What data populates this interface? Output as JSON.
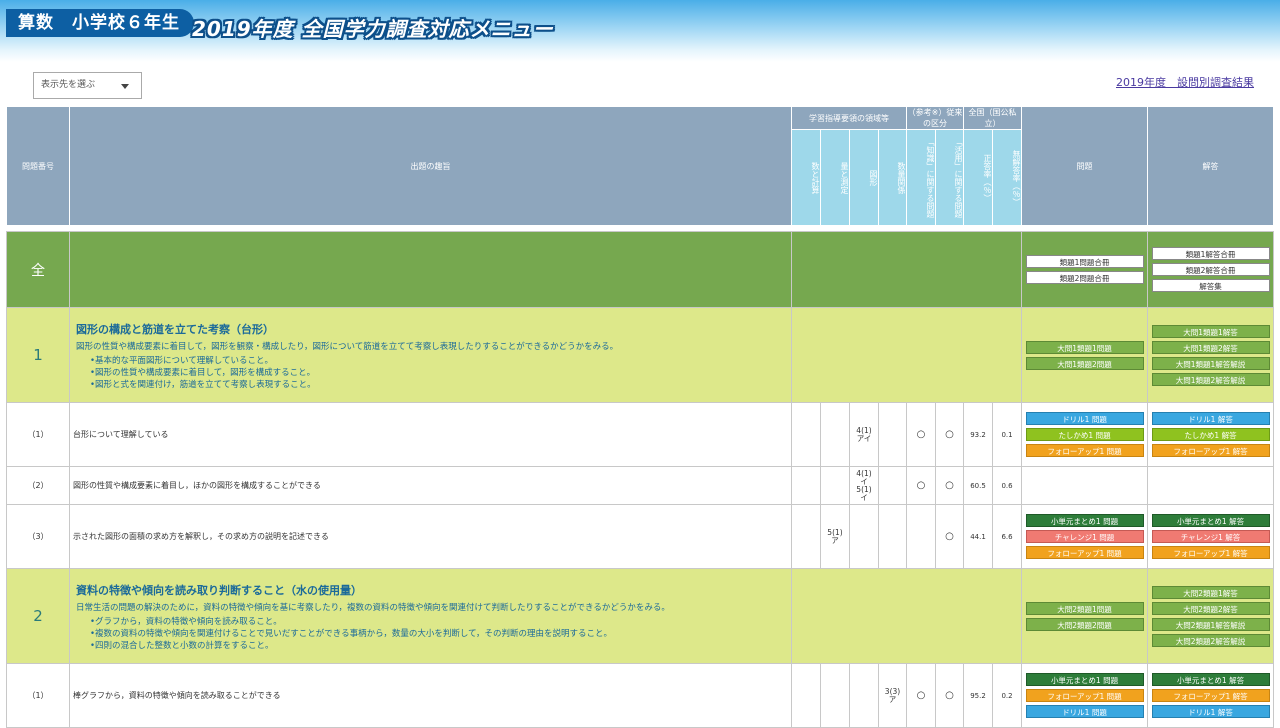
{
  "header": {
    "subject": "算数　小学校６年生",
    "title": "2019年度 全国学力調査対応メニュー"
  },
  "toolbar": {
    "select_value": "表示先を選ぶ",
    "link": "2019年度　設問別調査結果"
  },
  "columns": {
    "qnum": "問題番号",
    "aim": "出題の趣旨",
    "group1": "学習指導要領の領域等",
    "sub1": [
      "数と計算",
      "量と測定",
      "図形",
      "数量関係"
    ],
    "group2": "（参考※）従来の区分",
    "sub2": [
      "「知識」に関する問題",
      "「活用」に関する問題"
    ],
    "group3": "全国（国公私立）",
    "sub3": [
      "正答率（％）",
      "無解答率（％）"
    ],
    "problem": "問題",
    "answer": "解答"
  },
  "all_row": {
    "label": "全",
    "problem_buttons": [
      "類題1問題合冊",
      "類題2問題合冊"
    ],
    "answer_buttons": [
      "類題1解答合冊",
      "類題2解答合冊",
      "解答集"
    ]
  },
  "sections": [
    {
      "num": "1",
      "title": "図形の構成と筋道を立てた考察（台形）",
      "desc": "図形の性質や構成要素に着目して，図形を観察・構成したり，図形について筋道を立てて考察し表現したりすることができるかどうかをみる。",
      "bullets": [
        "基本的な平面図形について理解していること。",
        "図形の性質や構成要素に着目して，図形を構成すること。",
        "図形と式を関連付け，筋道を立てて考察し表現すること。"
      ],
      "problem_buttons": [
        "大問1類題1問題",
        "大問1類題2問題"
      ],
      "answer_buttons": [
        "大問1類題1解答",
        "大問1類題2解答",
        "大問1類題1解答解説",
        "大問1類題2解答解説"
      ],
      "subs": [
        {
          "num": "（1）",
          "aim": "台形について理解している",
          "c1": "",
          "c2": "",
          "c3": "4(1)\nアイ",
          "c4": "",
          "k1": "○",
          "k2": "○",
          "rate": "93.2",
          "none": "0.1",
          "problem_buttons": [
            {
              "t": "ドリル1 問題",
              "c": "blue"
            },
            {
              "t": "たしかめ1 問題",
              "c": "lime"
            },
            {
              "t": "フォローアップ1 問題",
              "c": "orange"
            }
          ],
          "answer_buttons": [
            {
              "t": "ドリル1 解答",
              "c": "blue"
            },
            {
              "t": "たしかめ1 解答",
              "c": "lime"
            },
            {
              "t": "フォローアップ1 解答",
              "c": "orange"
            }
          ]
        },
        {
          "num": "（2）",
          "aim": "図形の性質や構成要素に着目し，ほかの図形を構成することができる",
          "c1": "",
          "c2": "",
          "c3": "4(1)\nイ\n5(1)\nイ",
          "c4": "",
          "k1": "○",
          "k2": "○",
          "rate": "60.5",
          "none": "0.6",
          "problem_buttons": [],
          "answer_buttons": []
        },
        {
          "num": "（3）",
          "aim": "示された図形の面積の求め方を解釈し，その求め方の説明を記述できる",
          "c1": "",
          "c2": "5(1)\nア",
          "c3": "",
          "c4": "",
          "k1": "",
          "k2": "○",
          "rate": "44.1",
          "none": "6.6",
          "problem_buttons": [
            {
              "t": "小単元まとめ1 問題",
              "c": "dgreen"
            },
            {
              "t": "チャレンジ1 問題",
              "c": "red"
            },
            {
              "t": "フォローアップ1 問題",
              "c": "orange"
            }
          ],
          "answer_buttons": [
            {
              "t": "小単元まとめ1 解答",
              "c": "dgreen"
            },
            {
              "t": "チャレンジ1 解答",
              "c": "red"
            },
            {
              "t": "フォローアップ1 解答",
              "c": "orange"
            }
          ]
        }
      ]
    },
    {
      "num": "2",
      "title": "資料の特徴や傾向を読み取り判断すること（水の使用量）",
      "desc": "日常生活の問題の解決のために，資料の特徴や傾向を基に考察したり，複数の資料の特徴や傾向を関連付けて判断したりすることができるかどうかをみる。",
      "bullets": [
        "グラフから，資料の特徴や傾向を読み取ること。",
        "複数の資料の特徴や傾向を関連付けることで見いだすことができる事柄から，数量の大小を判断して，その判断の理由を説明すること。",
        "四則の混合した整数と小数の計算をすること。"
      ],
      "problem_buttons": [
        "大問2類題1問題",
        "大問2類題2問題"
      ],
      "answer_buttons": [
        "大問2類題1解答",
        "大問2類題2解答",
        "大問2類題1解答解説",
        "大問2類題2解答解説"
      ],
      "subs": [
        {
          "num": "（1）",
          "aim": "棒グラフから，資料の特徴や傾向を読み取ることができる",
          "c1": "",
          "c2": "",
          "c3": "",
          "c4": "3(3)\nア",
          "k1": "○",
          "k2": "○",
          "rate": "95.2",
          "none": "0.2",
          "problem_buttons": [
            {
              "t": "小単元まとめ1 問題",
              "c": "dgreen"
            },
            {
              "t": "フォローアップ1 問題",
              "c": "orange"
            },
            {
              "t": "ドリル1 問題",
              "c": "blue"
            }
          ],
          "answer_buttons": [
            {
              "t": "小単元まとめ1 解答",
              "c": "dgreen"
            },
            {
              "t": "フォローアップ1 解答",
              "c": "orange"
            },
            {
              "t": "ドリル1 解答",
              "c": "blue"
            }
          ]
        }
      ]
    }
  ]
}
